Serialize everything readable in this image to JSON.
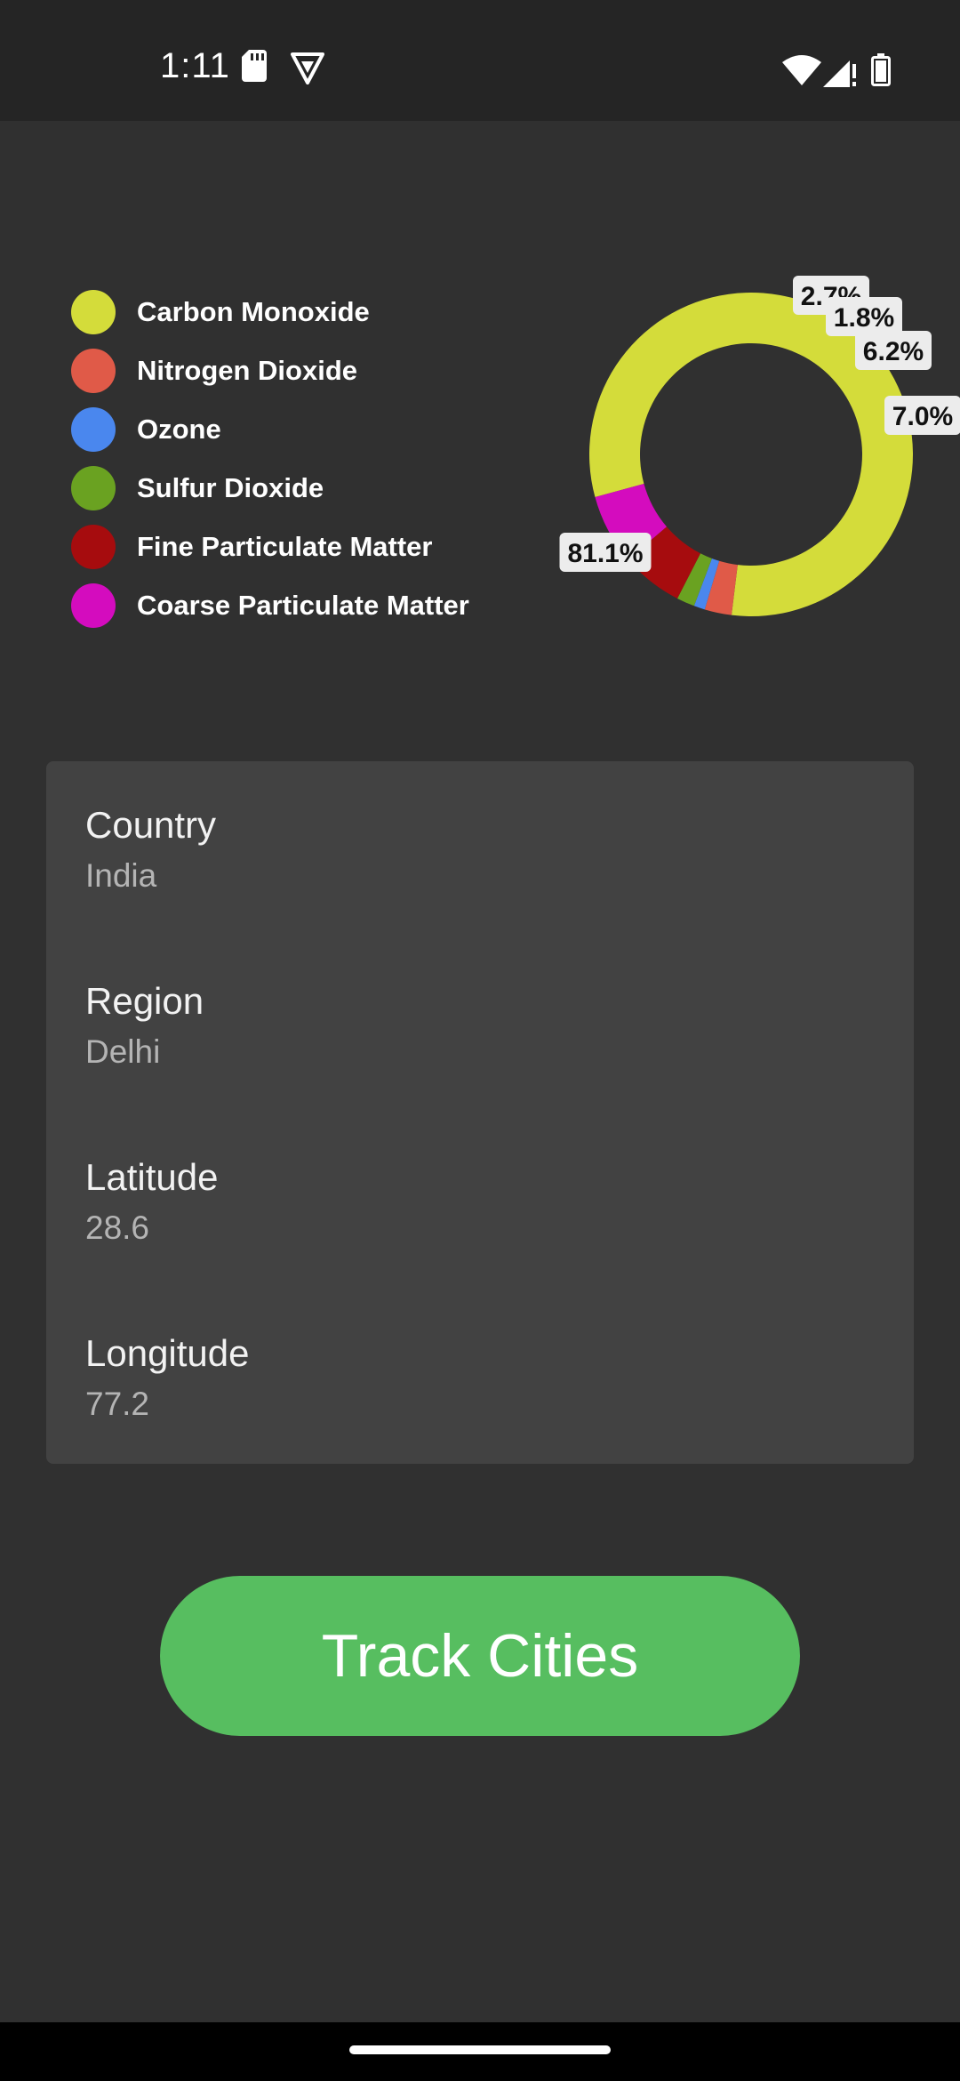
{
  "status_bar": {
    "time": "1:11",
    "icons": [
      "sd-card-icon",
      "vpn-shield-icon",
      "wifi-icon",
      "signal-icon",
      "battery-icon"
    ]
  },
  "chart_data": {
    "type": "donut",
    "slices": [
      {
        "name": "Carbon Monoxide",
        "value": 81.1,
        "label": "81.1%",
        "color": "#d4dc3a"
      },
      {
        "name": "Nitrogen Dioxide",
        "value": 2.7,
        "label": "2.7%",
        "color": "#e05a48"
      },
      {
        "name": "Ozone",
        "value": 1.1,
        "label": "",
        "color": "#4a87ee"
      },
      {
        "name": "Sulfur Dioxide",
        "value": 1.8,
        "label": "1.8%",
        "color": "#6aa221"
      },
      {
        "name": "Fine Particulate Matter",
        "value": 6.2,
        "label": "6.2%",
        "color": "#a60c0e"
      },
      {
        "name": "Coarse Particulate Matter",
        "value": 7.0,
        "label": "7.0%",
        "color": "#d40cbe"
      }
    ],
    "legend_position": "left"
  },
  "legend": [
    {
      "label": "Carbon Monoxide",
      "color": "#d4dc3a"
    },
    {
      "label": "Nitrogen Dioxide",
      "color": "#e05a48"
    },
    {
      "label": "Ozone",
      "color": "#4a87ee"
    },
    {
      "label": "Sulfur Dioxide",
      "color": "#6aa221"
    },
    {
      "label": "Fine Particulate Matter",
      "color": "#a60c0e"
    },
    {
      "label": "Coarse Particulate Matter",
      "color": "#d40cbe"
    }
  ],
  "info": {
    "country_label": "Country",
    "country_value": "India",
    "region_label": "Region",
    "region_value": "Delhi",
    "latitude_label": "Latitude",
    "latitude_value": "28.6",
    "longitude_label": "Longitude",
    "longitude_value": "77.2"
  },
  "actions": {
    "track_label": "Track Cities"
  },
  "colors": {
    "accent": "#57be60",
    "background": "#303030",
    "card": "#424242"
  }
}
